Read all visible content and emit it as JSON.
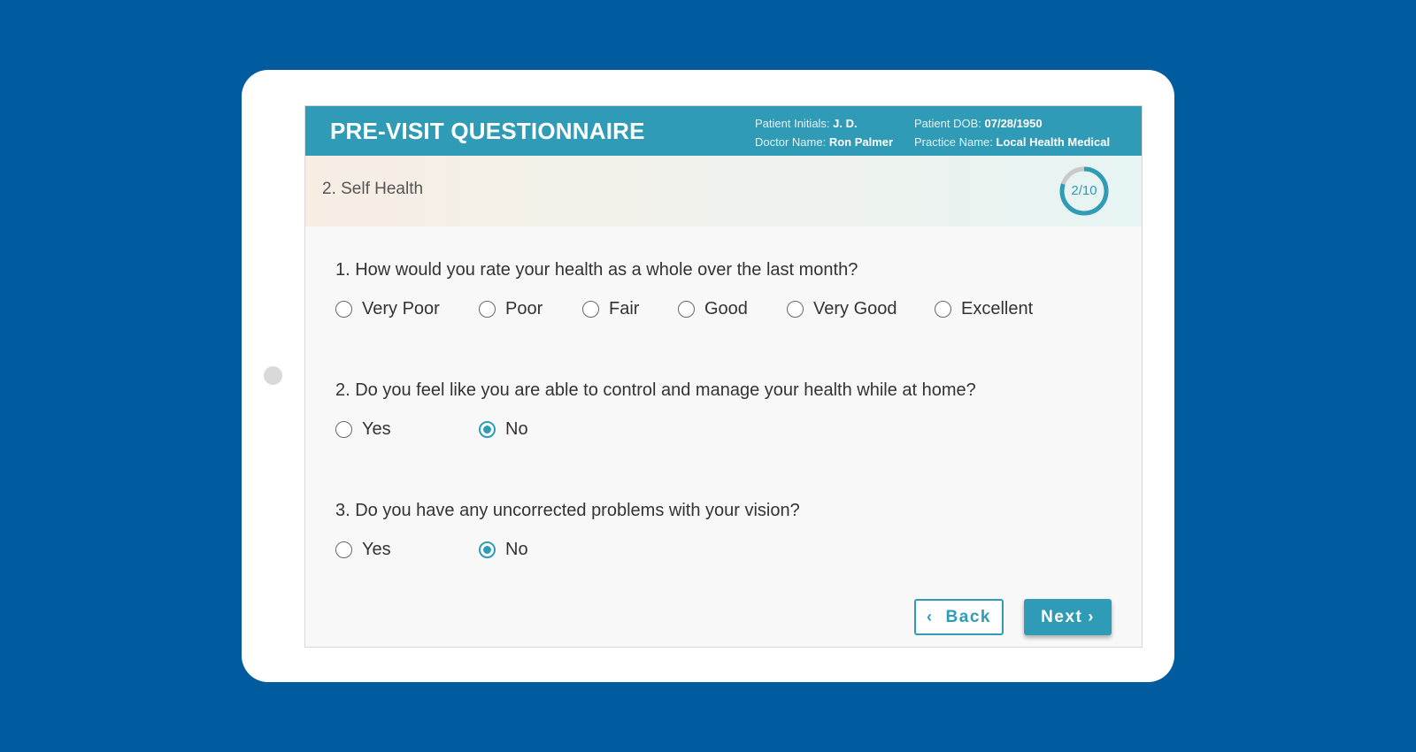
{
  "header": {
    "title": "PRE-VISIT QUESTIONNAIRE",
    "patient_initials_label": "Patient Initials:",
    "patient_initials": "J. D.",
    "doctor_name_label": "Doctor Name:",
    "doctor_name": "Ron Palmer",
    "patient_dob_label": "Patient DOB:",
    "patient_dob": "07/28/1950",
    "practice_name_label": "Practice Name:",
    "practice_name": "Local Health Medical"
  },
  "section": {
    "name": "2. Self Health",
    "progress_text": "2/10",
    "progress_current": 2,
    "progress_total": 10
  },
  "questions": [
    {
      "text": "1. How would you rate your health as a whole over the last month?",
      "options": [
        "Very Poor",
        "Poor",
        "Fair",
        "Good",
        "Very Good",
        "Excellent"
      ],
      "selected": null
    },
    {
      "text": "2. Do you feel like you are able to control and manage your health while at home?",
      "options": [
        "Yes",
        "No"
      ],
      "selected": "No"
    },
    {
      "text": "3. Do you have any uncorrected problems with your vision?",
      "options": [
        "Yes",
        "No"
      ],
      "selected": "No"
    }
  ],
  "buttons": {
    "back_label": "Back",
    "next_label": "Next",
    "back_icon": "chevron-left-icon",
    "next_icon": "chevron-right-icon"
  },
  "colors": {
    "accent": "#2f9bb6",
    "background": "#005c9f",
    "progress_track": "#c9c9c9"
  }
}
